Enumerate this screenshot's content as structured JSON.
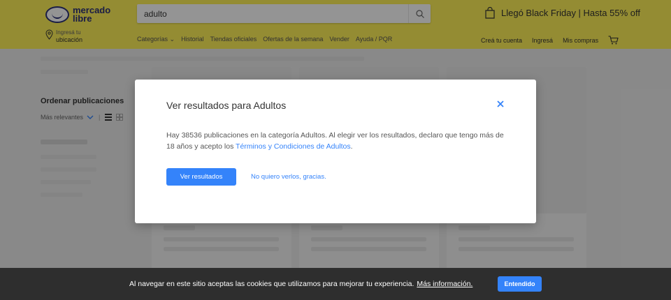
{
  "header": {
    "logo_line1": "mercado",
    "logo_line2": "libre",
    "search_value": "adulto",
    "promo_text": "Llegó Black Friday | Hasta 55% off",
    "location_line1": "Ingresá tu",
    "location_line2": "ubicación",
    "nav": [
      "Categorías ⌄",
      "Historial",
      "Tiendas oficiales",
      "Ofertas de la semana",
      "Vender",
      "Ayuda / PQR"
    ],
    "user_nav": [
      "Creá tu cuenta",
      "Ingresá",
      "Mis compras"
    ]
  },
  "sidebar": {
    "sort_title": "Ordenar publicaciones",
    "sort_value": "Más relevantes"
  },
  "modal": {
    "title": "Ver resultados para Adultos",
    "body": "Hay 38536 publicaciones en la categoría Adultos. Al elegir ver los resultados, declaro que tengo más de 18 años y acepto los ",
    "link": "Términos y Condiciones de Adultos",
    "body_end": ".",
    "primary_button": "Ver resultados",
    "secondary_button": "No quiero verlos, gracias."
  },
  "cookie_bar": {
    "text": "Al navegar en este sitio aceptas las cookies que utilizamos para mejorar tu experiencia.",
    "more": "Más información.",
    "button": "Entendido"
  },
  "colors": {
    "header_bg": "#fff159",
    "accent": "#3483fa",
    "cookie_bg": "#2e2e2e"
  }
}
